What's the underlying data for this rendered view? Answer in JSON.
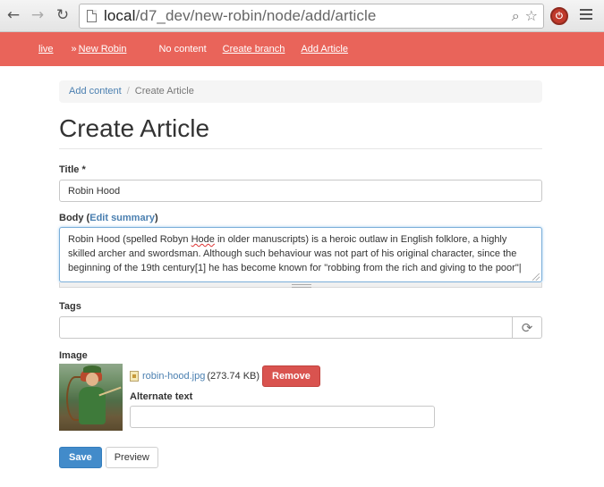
{
  "browser": {
    "back_icon": "arrow-left-icon",
    "forward_icon": "arrow-right-icon",
    "reload_icon": "reload-icon",
    "url_host": "local",
    "url_path": "/d7_dev/new-robin/node/add/article"
  },
  "adminbar": {
    "color": "#e9645a",
    "breadcrumb_live": "live",
    "breadcrumb_sep": "»",
    "breadcrumb_site": "New Robin",
    "no_content": "No content",
    "create_branch": "Create branch",
    "add_article": "Add Article"
  },
  "breadcrumb": {
    "link": "Add content",
    "sep": "/",
    "current": "Create Article"
  },
  "page_title": "Create Article",
  "form": {
    "title_label": "Title *",
    "title_value": "Robin Hood",
    "body_label_prefix": "Body (",
    "body_edit_summary": "Edit summary",
    "body_label_suffix": ")",
    "body_text_1": "Robin Hood (spelled Robyn ",
    "body_misspelled": "Hode",
    "body_text_2": " in older manuscripts) is a heroic outlaw in English folklore, a highly skilled archer and swordsman. Although such behaviour was not part of his original character, since the beginning of the 19th century[1] he has become known for \"robbing from the rich and giving to the poor\"",
    "tags_label": "Tags",
    "tags_value": "",
    "image_label": "Image",
    "file_name": "robin-hood.jpg",
    "file_size": "(273.74 KB)",
    "remove_button": "Remove",
    "alt_text_label": "Alternate text",
    "alt_text_value": "",
    "save_button": "Save",
    "preview_button": "Preview"
  },
  "colors": {
    "link": "#4a7fb0",
    "save": "#428bca",
    "remove": "#d9534f"
  }
}
